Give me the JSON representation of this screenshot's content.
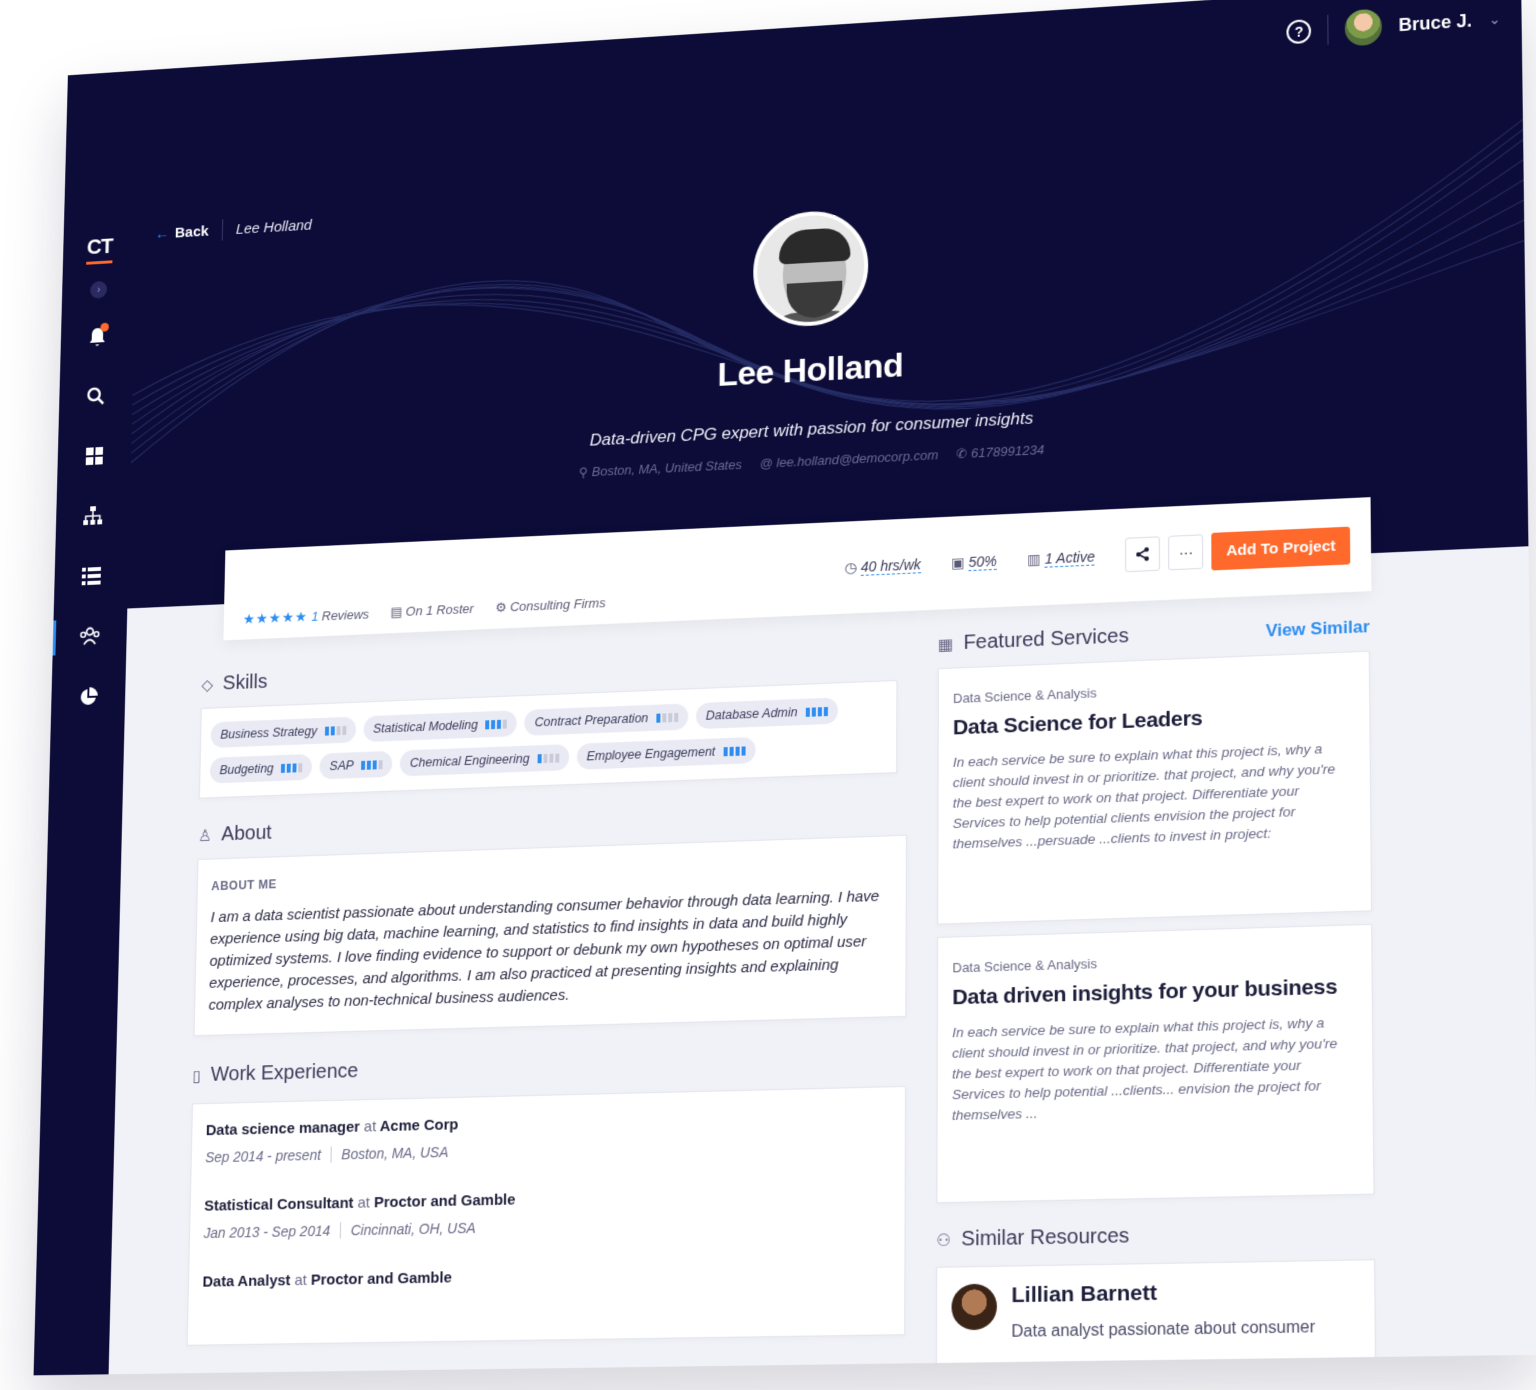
{
  "sidebar": {
    "logo": "CT",
    "toggle": "›",
    "items": [
      {
        "icon": "bell-icon"
      },
      {
        "icon": "search-icon"
      },
      {
        "icon": "grid-icon"
      },
      {
        "icon": "org-chart-icon"
      },
      {
        "icon": "list-icon"
      },
      {
        "icon": "people-icon"
      },
      {
        "icon": "pie-chart-icon"
      }
    ]
  },
  "topbar": {
    "back_label": "Back",
    "breadcrumb": "Lee Holland"
  },
  "user": {
    "help": "?",
    "name": "Bruce J.",
    "chevron": "⌄"
  },
  "profile": {
    "name": "Lee Holland",
    "tagline": "Data-driven CPG expert with passion for consumer insights",
    "location": "Boston, MA, United States",
    "email": "lee.holland@democorp.com",
    "phone": "6178991234"
  },
  "stats": {
    "stars": "★★★★★",
    "reviews_count": "1",
    "reviews_label": "Reviews",
    "roster": "On 1 Roster",
    "firms": "Consulting Firms",
    "hours": "40 hrs/wk",
    "utilization": "50%",
    "projects": "1 Active",
    "share": "share",
    "more": "···",
    "add_button": "Add To Project"
  },
  "skills": {
    "title": "Skills",
    "items": [
      {
        "label": "Business Strategy",
        "level": 2
      },
      {
        "label": "Statistical Modeling",
        "level": 3
      },
      {
        "label": "Contract Preparation",
        "level": 1
      },
      {
        "label": "Database Admin",
        "level": 4
      },
      {
        "label": "Budgeting",
        "level": 3
      },
      {
        "label": "SAP",
        "level": 3
      },
      {
        "label": "Chemical Engineering",
        "level": 1
      },
      {
        "label": "Employee Engagement",
        "level": 4
      }
    ]
  },
  "about": {
    "title": "About",
    "label": "ABOUT ME",
    "text": "I am a data scientist passionate about understanding consumer behavior through data learning. I have experience using big data, machine learning, and statistics to find insights in data and build highly optimized systems. I love finding evidence to support or debunk my own hypotheses on optimal user experience, processes, and algorithms. I am also practiced at presenting insights and explaining complex analyses to non-technical business audiences."
  },
  "work": {
    "title": "Work Experience",
    "jobs": [
      {
        "role": "Data science manager",
        "at": "at",
        "company": "Acme Corp",
        "dates": "Sep 2014  - present",
        "location": "Boston, MA, USA"
      },
      {
        "role": "Statistical Consultant",
        "at": "at",
        "company": "Proctor and Gamble",
        "dates": "Jan 2013  - Sep 2014",
        "location": "Cincinnati, OH, USA"
      },
      {
        "role": "Data Analyst",
        "at": "at",
        "company": "Proctor and Gamble",
        "dates": "",
        "location": ""
      }
    ]
  },
  "services": {
    "title": "Featured Services",
    "view_similar": "View Similar",
    "items": [
      {
        "category": "Data Science & Analysis",
        "title": "Data Science for Leaders",
        "desc": "In each service be sure to explain what this project is, why a client should invest in or prioritize. that project, and why you're the best expert to work on that project. Differentiate your Services to help potential clients envision the project for themselves ...persuade ...clients to invest in project:"
      },
      {
        "category": "Data Science & Analysis",
        "title": "Data driven insights for your business",
        "desc": "In each service be sure to explain what this project is, why a client should invest in or prioritize. that project, and why you're the best expert to work on that project. Differentiate your Services to help potential ...clients... envision the project for themselves ..."
      }
    ]
  },
  "similar": {
    "title": "Similar Resources",
    "person": {
      "name": "Lillian Barnett",
      "desc": "Data analyst passionate about consumer"
    }
  },
  "colors": {
    "navy": "#0d0c38",
    "accent": "#ff6a2c",
    "link": "#2d8df0"
  }
}
